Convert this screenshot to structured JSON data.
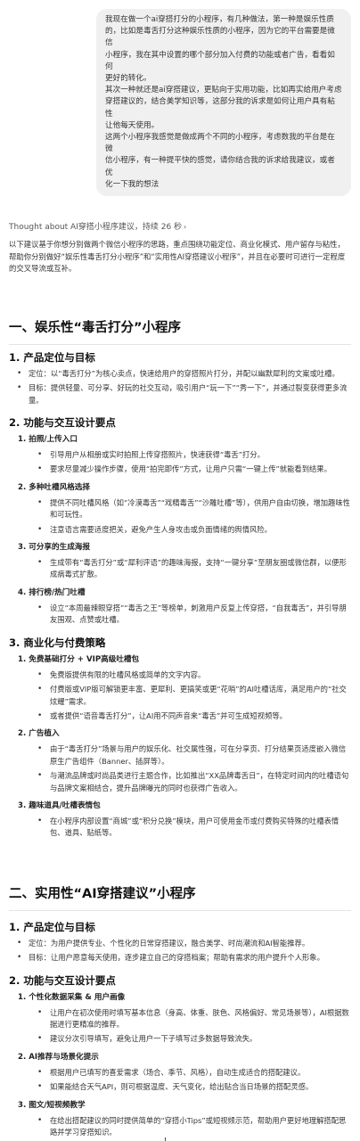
{
  "user_message": [
    "我现在做一个ai穿搭打分的小程序，有几种做法，第一种是娱乐性质",
    "的，比如是毒舌打分这种娱乐性质的小程序，因为它的平台需要是微信",
    "小程序，我在其中设置的哪个部分加入付费的功能或者广告，看看如何",
    "更好的转化。",
    "其次一种就还是ai穿搭建议，更贴向于实用功能，比如再实给用户考虑",
    "穿搭建议的，结合美学知识等，这部分我的诉求是如何让用户具有粘性",
    "让他每天使用。",
    "这两个小程序我感觉是做成两个不同的小程序，考虑数我的平台是在微",
    "信小程序，有一种提平快的感觉，请你结合我的诉求给我建议，或者优",
    "化一下我的想法"
  ],
  "thought": {
    "label": "Thought about AI穿搭小程序建议，持续 26 秒",
    "arrow": "›"
  },
  "intro": "以下建议基于你想分别做两个微信小程序的思路，重点围绕功能定位、商业化模式、用户留存与粘性，帮助你分别做好“娱乐性毒舌打分小程序”和“实用性AI穿搭建议小程序”，并且在必要时可进行一定程度的交叉导流或互补。",
  "sec1": {
    "title": "一、娱乐性“毒舌打分”小程序",
    "h_position": "1. 产品定位与目标",
    "position": [
      "定位：以“毒舌打分”为核心卖点，快速给用户的穿搭照片打分，并配以幽默犀利的文案或吐槽。",
      "目标：提供轻量、可分享、好玩的社交互动，吸引用户“玩一下”“秀一下”，并通过裂变获得更多流量。"
    ],
    "h_features": "2. 功能与交互设计要点",
    "features": [
      {
        "label": "1. 拍照/上传入口",
        "items": [
          "引导用户从相册或实时拍照上传穿搭照片，快速获得“毒舌”打分。",
          "要求尽量减少操作步骤，使用“拍完即传”方式，让用户只需“一键上传”就能看到结果。"
        ]
      },
      {
        "label": "2. 多种吐槽风格选择",
        "items": [
          "提供不同吐槽风格（如“冷漠毒舌”“戏精毒舌”“沙雕吐槽”等），供用户自由切换，增加趣味性和可玩性。",
          "注意语言需要适度把关，避免产生人身攻击或负面情绪的舆情风险。"
        ]
      },
      {
        "label": "3. 可分享的生成海报",
        "items": [
          "生成带有“毒舌打分”或“犀利评语”的趣味海报，支持“一键分享”至朋友圈或微信群，以便形成病毒式扩散。"
        ]
      },
      {
        "label": "4. 排行榜/热门吐槽",
        "items": [
          "设立“本周最辣眼穿搭”“毒舌之王”等榜单，刺激用户反复上传穿搭，“自我毒舌”，并引导朋友围观、点赞或吐槽。"
        ]
      }
    ],
    "h_monetize": "3. 商业化与付费策略",
    "monetize": [
      {
        "label": "1. 免费基础打分 + VIP高级吐槽包",
        "items": [
          "免费版提供有限的吐槽风格或简单的文字内容。",
          "付费版或VIP版可解锁更丰富、更犀利、更搞笑或更“花哨”的AI吐槽话库，满足用户的“社交炫耀”需求。",
          "或者提供“语音毒舌打分”，让AI用不同声音来“毒舌”并可生成短视频等。"
        ]
      },
      {
        "label": "2. 广告植入",
        "items": [
          "由于“毒舌打分”场景与用户的娱乐化、社交属性强，可在分享页、打分结果页适度嵌入微信原生广告组件（Banner、插屏等）。",
          "与潮流品牌或时尚品类进行主题合作，比如推出“XX品牌毒舌日”，在特定时间内的吐槽语句与品牌文案相结合，提升品牌曝光的同时也获得广告收入。"
        ]
      },
      {
        "label": "3. 趣味道具/吐槽表情包",
        "items": [
          "在小程序内部设置“商城”或“积分兑换”模块，用户可使用金币或付费购买特殊的吐槽表情包、道具、贴纸等。"
        ]
      }
    ]
  },
  "sec2": {
    "title": "二、实用性“AI穿搭建议”小程序",
    "h_position": "1. 产品定位与目标",
    "position": [
      "定位：为用户提供专业、个性化的日常穿搭建议，融合美学、时尚潮流和AI智能推荐。",
      "目标：让用户愿意每天使用，逐步建立自己的穿搭档案；帮助有需求的用户提升个人形象。"
    ],
    "h_features": "2. 功能与交互设计要点",
    "features": [
      {
        "label": "1. 个性化数据采集 & 用户画像",
        "items": [
          "让用户在初次使用时填写基本信息（身高、体重、肤色、风格偏好、常见场景等），AI根据数据进行更精准的推荐。",
          "建议分次引导填写，避免让用户一下子填写过多数据导致流失。"
        ]
      },
      {
        "label": "2. AI推荐与场景化提示",
        "items": [
          "根据用户已填写的喜爱需求（场合、季节、风格），自动生成适合的搭配建议。",
          "如果能结合天气API，则可根据温度、天气变化，给出贴合当日场景的搭配灵感。"
        ]
      },
      {
        "label": "3. 图文/短视频教学",
        "items": [
          "在给出搭配建议的同时提供简单的“穿搭小Tips”或短视频示范，帮助用户更好地理解搭配思路并学习穿搭知识。"
        ]
      }
    ]
  },
  "icons": {
    "scroll_down": "↓"
  }
}
